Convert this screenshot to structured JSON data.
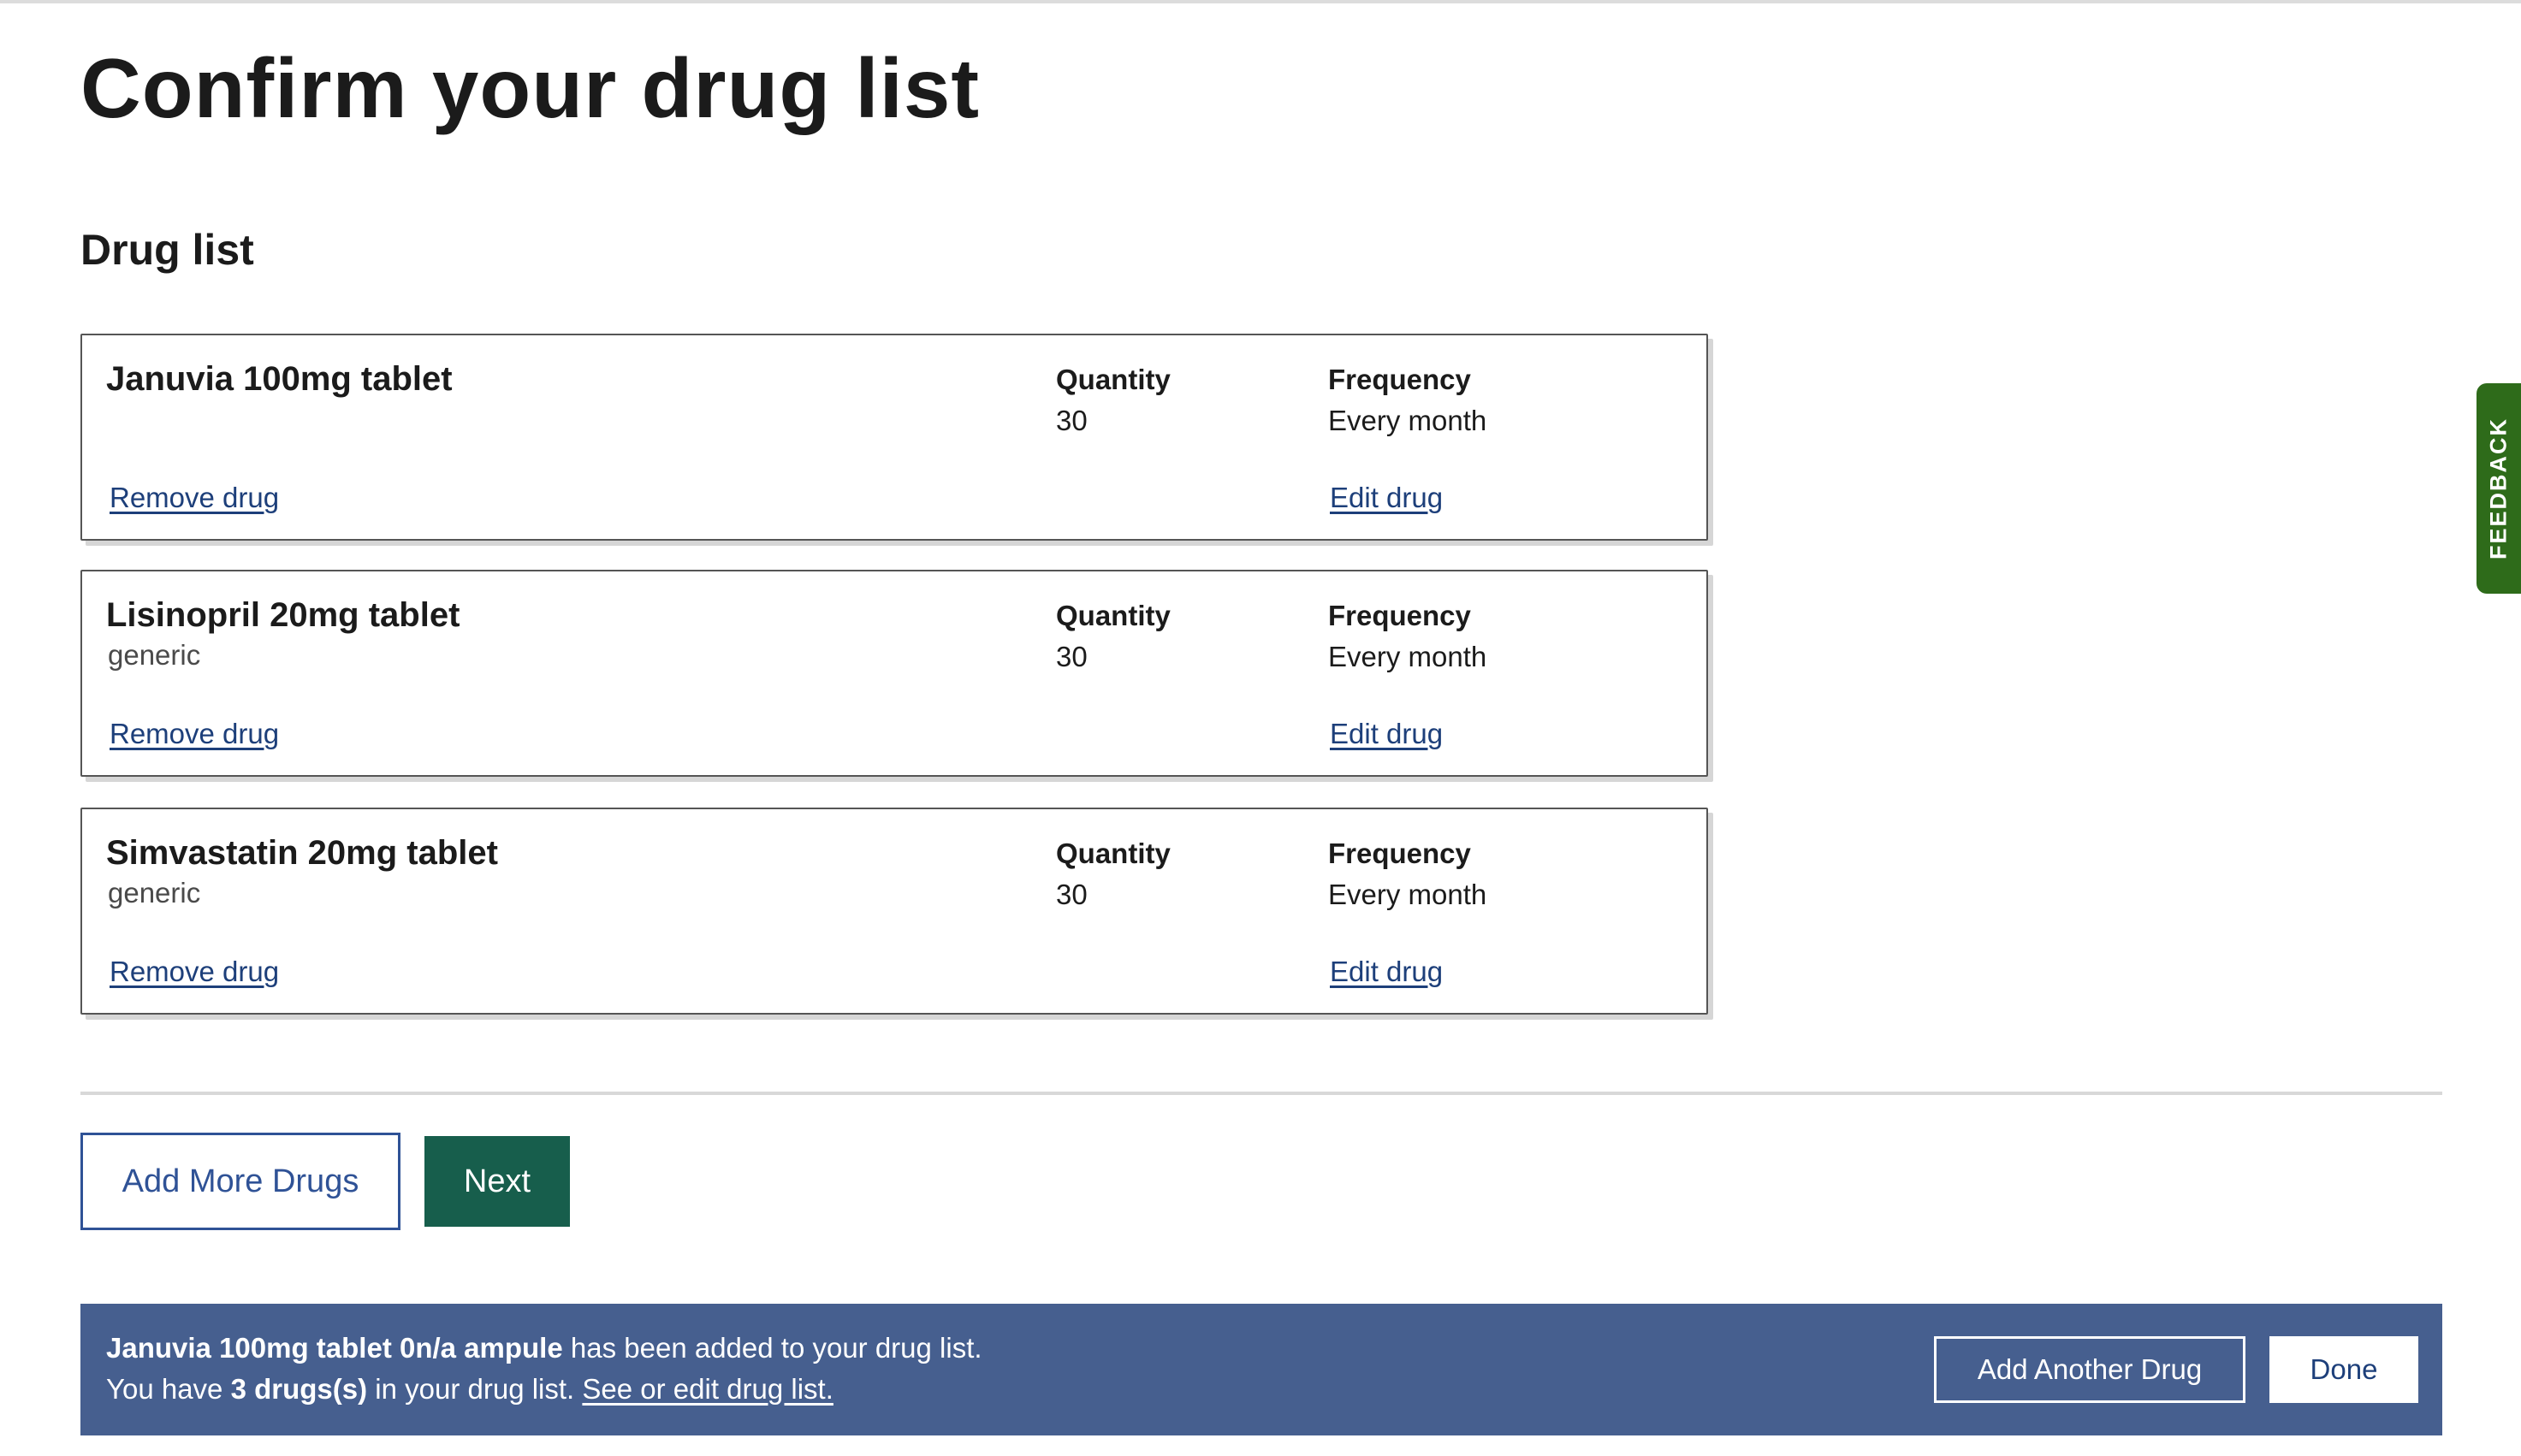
{
  "page": {
    "title": "Confirm your drug list",
    "section_title": "Drug list"
  },
  "columns": {
    "quantity_label": "Quantity",
    "frequency_label": "Frequency"
  },
  "drugs": [
    {
      "name": "Januvia 100mg tablet",
      "type": "",
      "quantity": "30",
      "frequency": "Every month",
      "remove_label": "Remove drug",
      "edit_label": "Edit drug"
    },
    {
      "name": "Lisinopril 20mg tablet",
      "type": "generic",
      "quantity": "30",
      "frequency": "Every month",
      "remove_label": "Remove drug",
      "edit_label": "Edit drug"
    },
    {
      "name": "Simvastatin 20mg tablet",
      "type": "generic",
      "quantity": "30",
      "frequency": "Every month",
      "remove_label": "Remove drug",
      "edit_label": "Edit drug"
    }
  ],
  "actions": {
    "add_more_label": "Add More Drugs",
    "next_label": "Next"
  },
  "toast": {
    "added_drug": "Januvia 100mg tablet 0n/a ampule",
    "added_suffix": " has been added to your drug list.",
    "count_prefix": "You have ",
    "count_bold": "3 drugs(s)",
    "count_suffix": " in your drug list. ",
    "see_edit_link": "See or edit drug list.",
    "add_another_label": "Add Another Drug",
    "done_label": "Done"
  },
  "feedback": {
    "label": "FEEDBACK"
  },
  "colors": {
    "primary_green": "#175e4c",
    "link_blue": "#1d3f7a",
    "toast_bg": "#465f8f",
    "feedback_green": "#2e6b1a"
  }
}
